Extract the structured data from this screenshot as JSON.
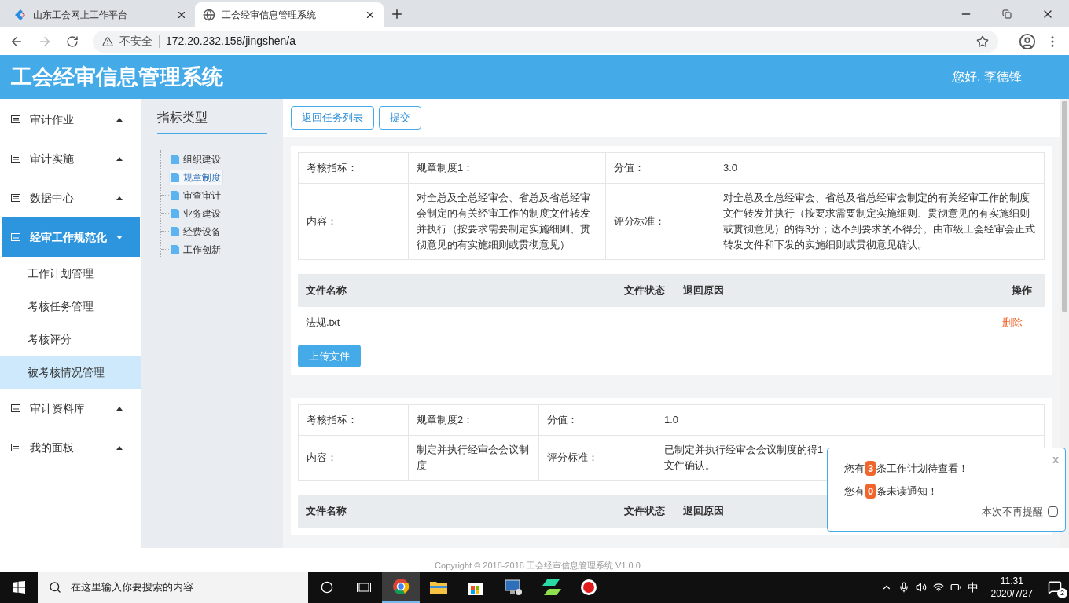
{
  "browser": {
    "tabs": [
      {
        "title": "山东工会网上工作平台",
        "selected": false,
        "kind": "logo"
      },
      {
        "title": "工会经审信息管理系统",
        "selected": true,
        "kind": "globe"
      }
    ],
    "security": "不安全",
    "url": "172.20.232.158/jingshen/a"
  },
  "header": {
    "title": "工会经审信息管理系统",
    "greeting": "您好, 李德锋"
  },
  "sidebar": {
    "items": [
      {
        "label": "审计作业",
        "selected": false,
        "expanded": false
      },
      {
        "label": "审计实施",
        "selected": false,
        "expanded": false
      },
      {
        "label": "数据中心",
        "selected": false,
        "expanded": false
      },
      {
        "label": "经审工作规范化",
        "selected": true,
        "expanded": true,
        "children": [
          {
            "label": "工作计划管理",
            "selected": false
          },
          {
            "label": "考核任务管理",
            "selected": false
          },
          {
            "label": "考核评分",
            "selected": false
          },
          {
            "label": "被考核情况管理",
            "selected": true
          }
        ]
      },
      {
        "label": "审计资料库",
        "selected": false,
        "expanded": false
      },
      {
        "label": "我的面板",
        "selected": false,
        "expanded": false
      }
    ]
  },
  "tree": {
    "title": "指标类型",
    "items": [
      {
        "label": "组织建设",
        "selected": false
      },
      {
        "label": "规章制度",
        "selected": true
      },
      {
        "label": "审查审计",
        "selected": false
      },
      {
        "label": "业务建设",
        "selected": false
      },
      {
        "label": "经费设备",
        "selected": false
      },
      {
        "label": "工作创新",
        "selected": false
      }
    ]
  },
  "toolbar": [
    "返回任务列表",
    "提交"
  ],
  "cards": [
    {
      "index_label": "考核指标：",
      "name": "规章制度1：",
      "score_label": "分值：",
      "score": "3.0",
      "content_label": "内容：",
      "content": "对全总及全总经审会、省总及省总经审会制定的有关经审工作的制度文件转发并执行（按要求需要制定实施细则、贯彻意见的有实施细则或贯彻意见）",
      "criteria_label": "评分标准：",
      "criteria": [
        "对全总及全总经审会、省总及省总经审会制定的有关经审工作的制度文件转发并执行（按要求需要制定实施细则、贯彻意见的有实施细则或贯彻意见）的得3分；达不到要求的不得分。由市级工会经审会正式转发文件和下发的实施细则或贯彻意见确认。"
      ],
      "columns": [
        "文件名称",
        "文件状态",
        "退回原因",
        "操作"
      ],
      "rows": [
        {
          "name": "法规.txt",
          "status": "",
          "reason": "",
          "action": "删除"
        }
      ],
      "upload": "上传文件"
    },
    {
      "index_label": "考核指标：",
      "name": "规章制度2：",
      "score_label": "分值：",
      "score": "1.0",
      "content_label": "内容：",
      "content": "制定并执行经审会会议制度",
      "criteria_label": "评分标准：",
      "criteria": [
        "已制定并执行经审会会议制度的得1",
        "文件确认。"
      ],
      "columns": [
        "文件名称",
        "文件状态",
        "退回原因"
      ]
    }
  ],
  "footer": "Copyright © 2018-2018 工会经审信息管理系统 V1.0.0",
  "popup": {
    "close": "x",
    "lines": [
      {
        "before": "您有",
        "count": "3",
        "after": "条工作计划待查看！"
      },
      {
        "before": "您有",
        "count": "0",
        "after": "条未读通知！"
      }
    ],
    "option": {
      "label": "本次不再提醒",
      "checked": false
    }
  },
  "taskbar": {
    "search_placeholder": "在这里输入你要搜索的内容",
    "ime": "中",
    "time": "11:31",
    "date": "2020/7/27",
    "notifications": "2"
  }
}
